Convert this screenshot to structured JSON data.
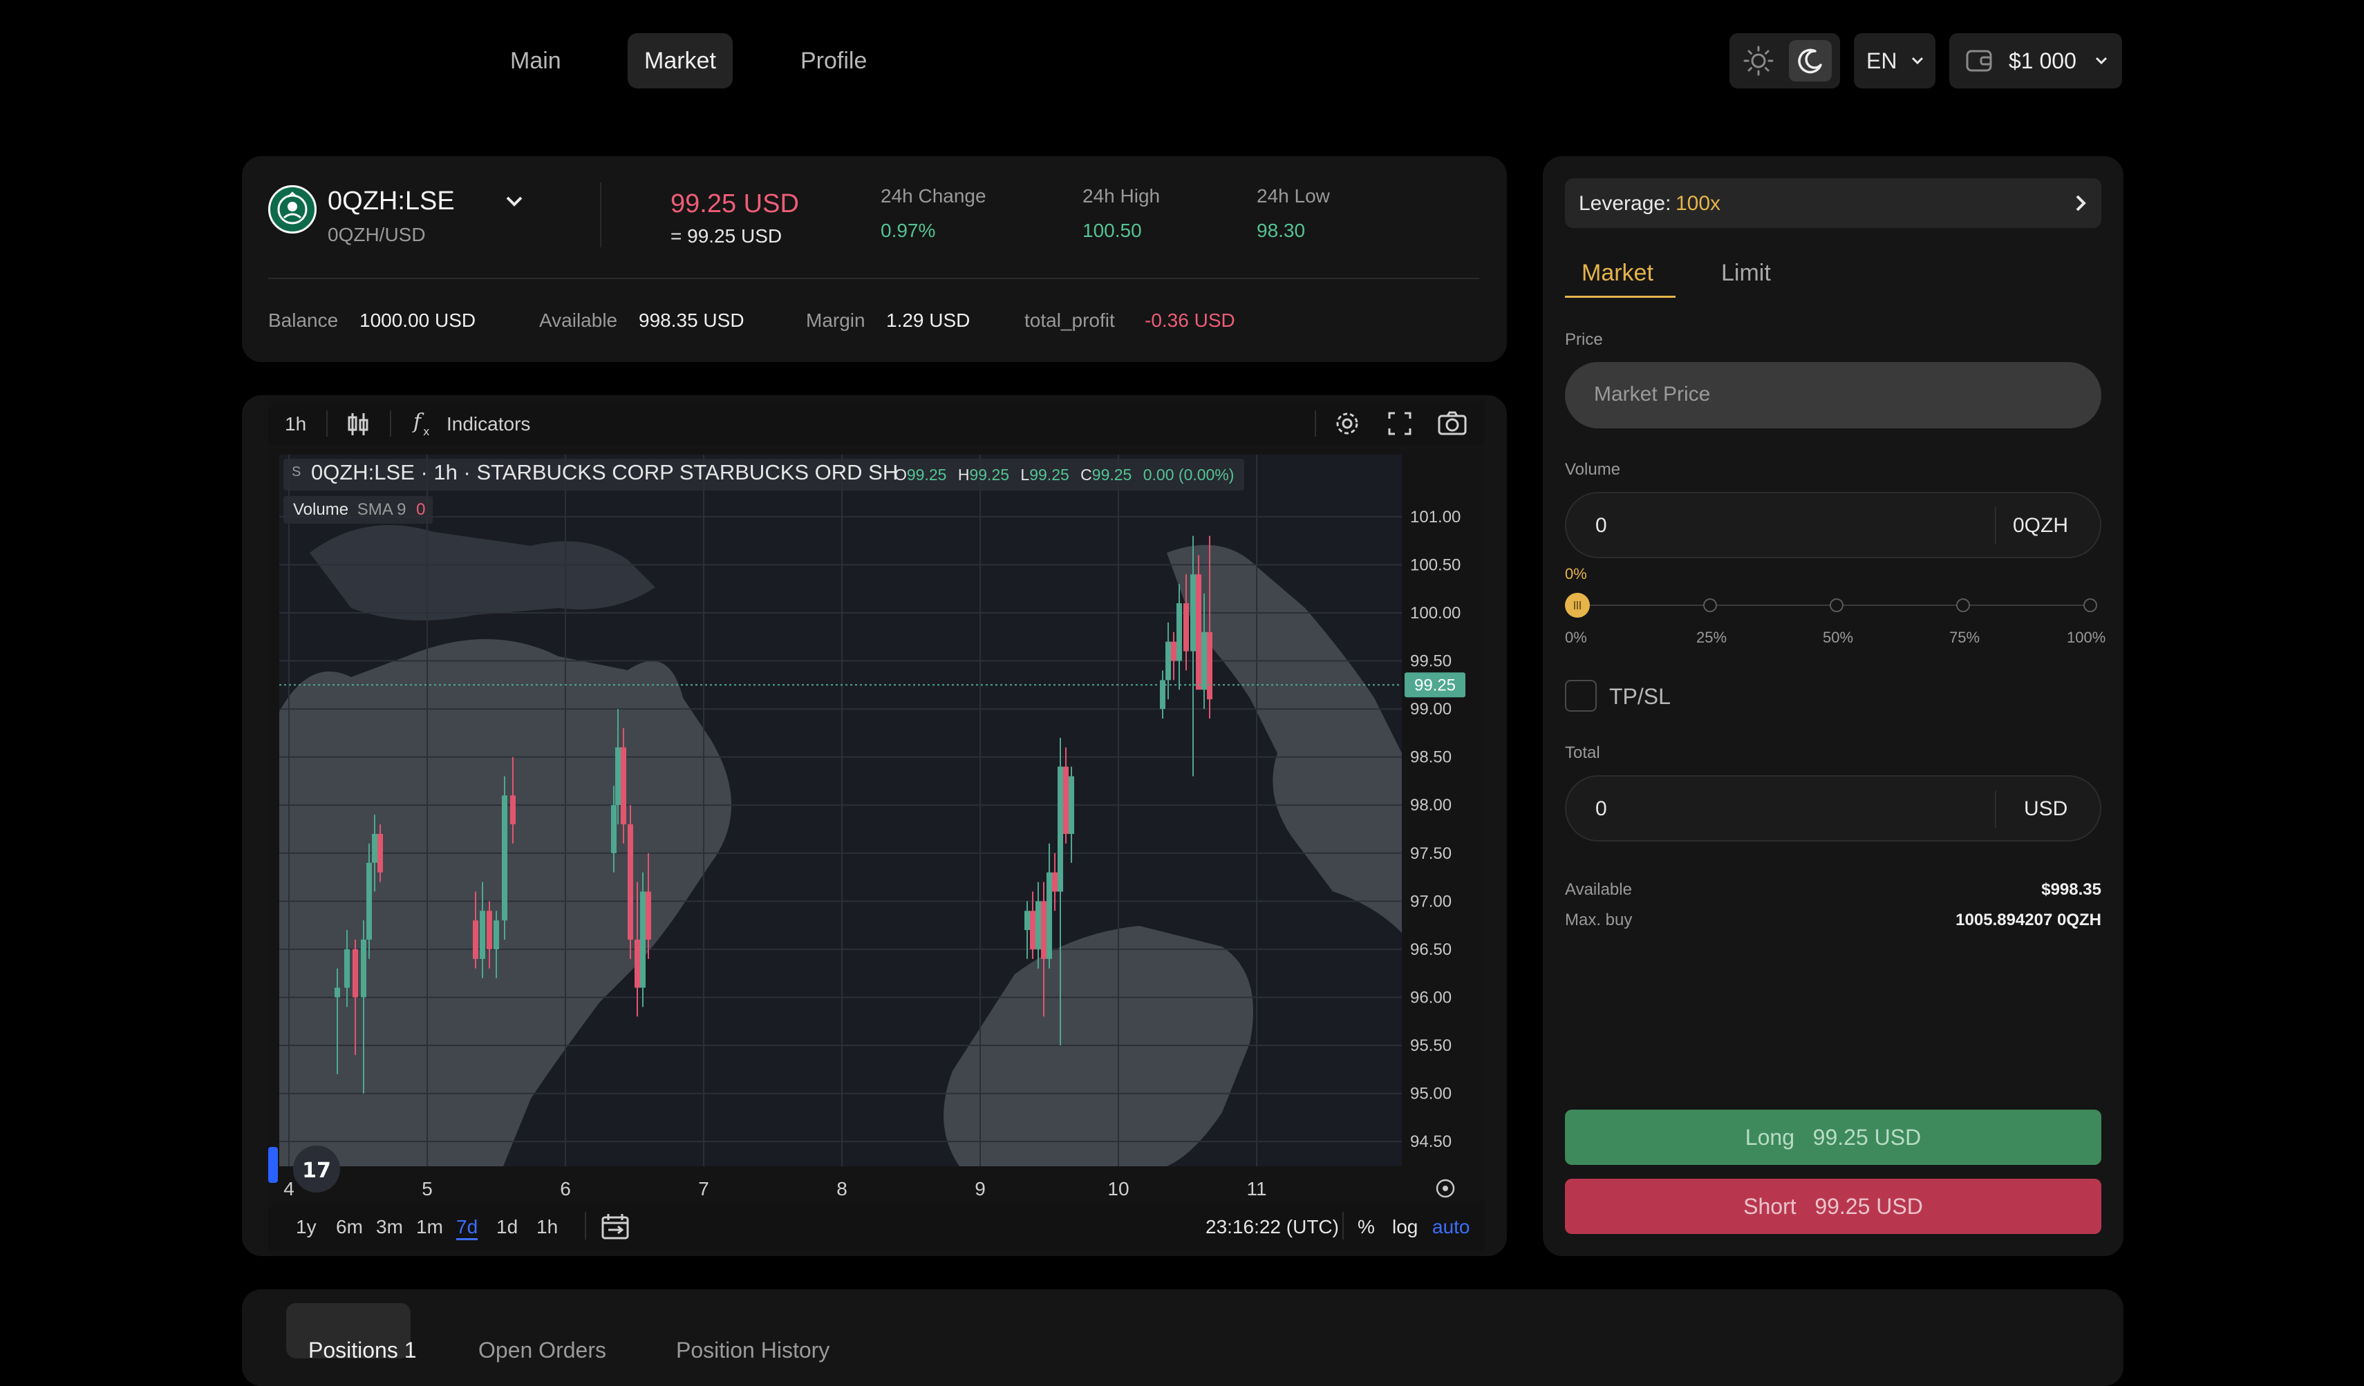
{
  "nav": {
    "items": [
      {
        "label": "Main"
      },
      {
        "label": "Market"
      },
      {
        "label": "Profile"
      }
    ],
    "active": "Market",
    "language": "EN",
    "wallet_balance": "$1 000"
  },
  "ticker": {
    "symbol": "0QZH:LSE",
    "pair": "0QZH/USD",
    "price": "99.25 USD",
    "price_equiv": "= 99.25 USD",
    "change_label": "24h Change",
    "change_value": "0.97%",
    "high_label": "24h High",
    "high_value": "100.50",
    "low_label": "24h Low",
    "low_value": "98.30"
  },
  "account": {
    "balance_label": "Balance",
    "balance_value": "1000.00 USD",
    "available_label": "Available",
    "available_value": "998.35 USD",
    "margin_label": "Margin",
    "margin_value": "1.29 USD",
    "profit_label": "total_profit",
    "profit_value": "-0.36 USD"
  },
  "chart_toolbar": {
    "interval": "1h",
    "indicators_label": "Indicators"
  },
  "chart_legend": {
    "symbol_line": "0QZH:LSE · 1h · STARBUCKS CORP STARBUCKS ORD SH",
    "o_label": "O",
    "o_value": "99.25",
    "h_label": "H",
    "h_value": "99.25",
    "l_label": "L",
    "l_value": "99.25",
    "c_label": "C",
    "c_value": "99.25",
    "change": "0.00 (0.00%)",
    "volume_label": "Volume",
    "sma_label": "SMA 9",
    "sma_value": "0",
    "s_badge": "S"
  },
  "chart_footer": {
    "ranges": [
      "1y",
      "6m",
      "3m",
      "1m",
      "7d",
      "1d",
      "1h"
    ],
    "active_range": "7d",
    "time": "23:16:22 (UTC)",
    "pct": "%",
    "log": "log",
    "auto": "auto"
  },
  "chart_data": {
    "type": "candlestick",
    "x_ticks": [
      "4",
      "5",
      "6",
      "7",
      "8",
      "9",
      "10",
      "11"
    ],
    "y_ticks": [
      "101.00",
      "100.50",
      "100.00",
      "99.50",
      "99.00",
      "98.50",
      "98.00",
      "97.50",
      "97.00",
      "96.50",
      "96.00",
      "95.50",
      "95.00",
      "94.50"
    ],
    "ylim": [
      94.3,
      101.2
    ],
    "last_price": "99.25",
    "colors": {
      "up": "#4fa88f",
      "down": "#e0566f"
    },
    "candles": [
      {
        "t": 4.35,
        "o": 96.0,
        "h": 96.3,
        "l": 95.2,
        "c": 96.1
      },
      {
        "t": 4.42,
        "o": 96.1,
        "h": 96.7,
        "l": 95.9,
        "c": 96.5
      },
      {
        "t": 4.48,
        "o": 96.5,
        "h": 96.6,
        "l": 95.4,
        "c": 96.0
      },
      {
        "t": 4.54,
        "o": 96.0,
        "h": 96.8,
        "l": 95.0,
        "c": 96.6
      },
      {
        "t": 4.58,
        "o": 96.6,
        "h": 97.6,
        "l": 96.4,
        "c": 97.4
      },
      {
        "t": 4.62,
        "o": 97.4,
        "h": 97.9,
        "l": 97.1,
        "c": 97.7
      },
      {
        "t": 4.66,
        "o": 97.7,
        "h": 97.8,
        "l": 97.2,
        "c": 97.3
      },
      {
        "t": 5.35,
        "o": 96.8,
        "h": 97.1,
        "l": 96.3,
        "c": 96.4
      },
      {
        "t": 5.4,
        "o": 96.4,
        "h": 97.2,
        "l": 96.2,
        "c": 96.9
      },
      {
        "t": 5.45,
        "o": 96.9,
        "h": 97.0,
        "l": 96.3,
        "c": 96.5
      },
      {
        "t": 5.5,
        "o": 96.5,
        "h": 96.9,
        "l": 96.2,
        "c": 96.8
      },
      {
        "t": 5.56,
        "o": 96.8,
        "h": 98.3,
        "l": 96.6,
        "c": 98.1
      },
      {
        "t": 5.62,
        "o": 98.1,
        "h": 98.5,
        "l": 97.6,
        "c": 97.8
      },
      {
        "t": 6.35,
        "o": 97.5,
        "h": 98.2,
        "l": 97.3,
        "c": 98.0
      },
      {
        "t": 6.38,
        "o": 98.0,
        "h": 99.0,
        "l": 97.8,
        "c": 98.6
      },
      {
        "t": 6.42,
        "o": 98.6,
        "h": 98.8,
        "l": 97.6,
        "c": 97.8
      },
      {
        "t": 6.47,
        "o": 97.8,
        "h": 98.0,
        "l": 96.4,
        "c": 96.6
      },
      {
        "t": 6.52,
        "o": 96.6,
        "h": 97.2,
        "l": 95.8,
        "c": 96.1
      },
      {
        "t": 6.56,
        "o": 96.1,
        "h": 97.3,
        "l": 95.9,
        "c": 97.1
      },
      {
        "t": 6.6,
        "o": 97.1,
        "h": 97.5,
        "l": 96.4,
        "c": 96.6
      },
      {
        "t": 9.34,
        "o": 96.7,
        "h": 97.0,
        "l": 96.4,
        "c": 96.9
      },
      {
        "t": 9.38,
        "o": 96.9,
        "h": 97.1,
        "l": 96.4,
        "c": 96.5
      },
      {
        "t": 9.42,
        "o": 96.5,
        "h": 97.2,
        "l": 96.3,
        "c": 97.0
      },
      {
        "t": 9.46,
        "o": 97.0,
        "h": 97.2,
        "l": 95.8,
        "c": 96.4
      },
      {
        "t": 9.5,
        "o": 96.4,
        "h": 97.6,
        "l": 96.3,
        "c": 97.3
      },
      {
        "t": 9.54,
        "o": 97.3,
        "h": 97.5,
        "l": 96.9,
        "c": 97.1
      },
      {
        "t": 9.58,
        "o": 97.1,
        "h": 98.7,
        "l": 95.5,
        "c": 98.4
      },
      {
        "t": 9.62,
        "o": 98.4,
        "h": 98.6,
        "l": 97.6,
        "c": 97.7
      },
      {
        "t": 9.66,
        "o": 97.7,
        "h": 98.4,
        "l": 97.4,
        "c": 98.3
      },
      {
        "t": 10.32,
        "o": 99.0,
        "h": 99.4,
        "l": 98.9,
        "c": 99.3
      },
      {
        "t": 10.36,
        "o": 99.3,
        "h": 99.9,
        "l": 99.1,
        "c": 99.7
      },
      {
        "t": 10.4,
        "o": 99.7,
        "h": 99.8,
        "l": 99.3,
        "c": 99.5
      },
      {
        "t": 10.44,
        "o": 99.5,
        "h": 100.3,
        "l": 99.2,
        "c": 100.1
      },
      {
        "t": 10.49,
        "o": 100.1,
        "h": 100.4,
        "l": 99.4,
        "c": 99.6
      },
      {
        "t": 10.54,
        "o": 99.6,
        "h": 100.8,
        "l": 98.3,
        "c": 100.4
      },
      {
        "t": 10.58,
        "o": 100.4,
        "h": 100.6,
        "l": 99.5,
        "c": 99.2
      },
      {
        "t": 10.62,
        "o": 99.2,
        "h": 100.2,
        "l": 99.0,
        "c": 99.8
      },
      {
        "t": 10.66,
        "o": 99.8,
        "h": 100.8,
        "l": 98.9,
        "c": 99.1
      }
    ]
  },
  "order_panel": {
    "leverage_label": "Leverage:",
    "leverage_value": "100x",
    "tabs": [
      {
        "label": "Market"
      },
      {
        "label": "Limit"
      }
    ],
    "active_tab": "Market",
    "price_label": "Price",
    "price_placeholder": "Market Price",
    "volume_label": "Volume",
    "volume_value": "0",
    "volume_unit": "0QZH",
    "slider_value": "0%",
    "slider_level": 0,
    "slider_marks": [
      "0%",
      "25%",
      "50%",
      "75%",
      "100%"
    ],
    "tpsl_label": "TP/SL",
    "total_label": "Total",
    "total_value": "0",
    "total_unit": "USD",
    "available_label": "Available",
    "available_value": "$998.35",
    "maxbuy_label": "Max. buy",
    "maxbuy_value": "1005.894207 0QZH",
    "long_label": "Long   99.25 USD",
    "short_label": "Short   99.25 USD"
  },
  "bottom_tabs": [
    {
      "label": "Positions 1"
    },
    {
      "label": "Open Orders"
    },
    {
      "label": "Position History"
    }
  ]
}
